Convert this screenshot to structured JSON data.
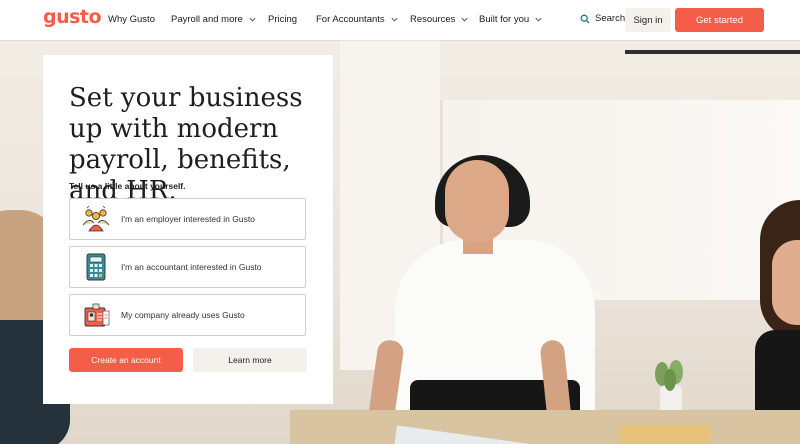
{
  "brand": {
    "logo_text": "gusto",
    "accent_color": "#f45d48",
    "neutral_button_color": "#f4f1ec"
  },
  "nav": {
    "items": [
      {
        "label": "Why Gusto",
        "has_dropdown": false
      },
      {
        "label": "Payroll and more",
        "has_dropdown": true
      },
      {
        "label": "Pricing",
        "has_dropdown": false
      },
      {
        "label": "For Accountants",
        "has_dropdown": true
      },
      {
        "label": "Resources",
        "has_dropdown": true
      },
      {
        "label": "Built for you",
        "has_dropdown": true
      }
    ],
    "search_label": "Search",
    "signin_label": "Sign in",
    "cta_label": "Get started"
  },
  "hero": {
    "headline": "Set your business up with modern payroll, benefits, and HR.",
    "subtitle": "Tell us a little about yourself.",
    "options": [
      {
        "label": "I'm an employer interested in Gusto",
        "icon": "team-icon"
      },
      {
        "label": "I'm an accountant interested in Gusto",
        "icon": "calculator-icon"
      },
      {
        "label": "My company already uses Gusto",
        "icon": "id-badge-icon"
      }
    ],
    "primary_button": "Create an account",
    "secondary_button": "Learn more"
  }
}
